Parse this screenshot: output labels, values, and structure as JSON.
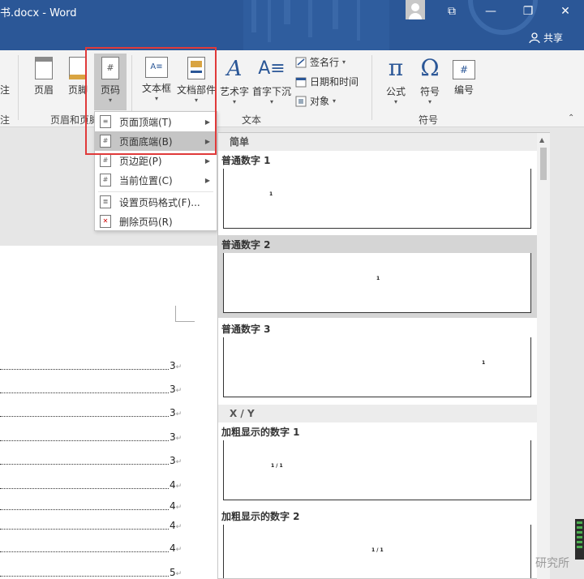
{
  "titlebar": {
    "title": "书.docx  -  Word",
    "restore_glyph": "⧉",
    "minimize_glyph": "—",
    "maximize_glyph": "❐",
    "close_glyph": "✕",
    "share_label": "共享"
  },
  "ribbon": {
    "partial_left_text": "注",
    "buttons": {
      "header": "页眉",
      "footer": "页脚",
      "page_number": "页码",
      "textbox": "文本框",
      "doc_parts": "文档部件",
      "wordart": "艺术字",
      "dropcap": "首字下沉",
      "formula": "公式",
      "symbol": "符号",
      "number": "编号"
    },
    "small_buttons": {
      "signature": "签名行",
      "datetime": "日期和时间",
      "object": "对象"
    },
    "groups": {
      "partial_left": "注",
      "header_footer": "页眉和页脚",
      "text": "文本",
      "symbols": "符号"
    }
  },
  "menu": {
    "items": [
      {
        "label": "页面顶端(T)",
        "has_submenu": true
      },
      {
        "label": "页面底端(B)",
        "has_submenu": true
      },
      {
        "label": "页边距(P)",
        "has_submenu": true
      },
      {
        "label": "当前位置(C)",
        "has_submenu": true
      },
      {
        "label": "设置页码格式(F)...",
        "has_submenu": false
      },
      {
        "label": "删除页码(R)",
        "has_submenu": false
      }
    ]
  },
  "gallery": {
    "sections": [
      {
        "title": "简单"
      },
      {
        "title": "X / Y"
      }
    ],
    "items": [
      {
        "label": "普通数字 1",
        "preview": "1"
      },
      {
        "label": "普通数字 2",
        "preview": "1"
      },
      {
        "label": "普通数字 3",
        "preview": "1"
      },
      {
        "label": "加粗显示的数字 1",
        "preview": "1 / 1"
      },
      {
        "label": "加粗显示的数字 2",
        "preview": "1 / 1"
      }
    ]
  },
  "toc": {
    "page_numbers": [
      "3",
      "3",
      "3",
      "3",
      "3",
      "4",
      "4",
      "4",
      "4",
      "5"
    ],
    "return_glyph": "↵"
  },
  "watermark": "研究所",
  "colors": {
    "title_bar": "#2b5797",
    "highlight": "#e03a3a",
    "ribbon": "#f3f3f3"
  }
}
